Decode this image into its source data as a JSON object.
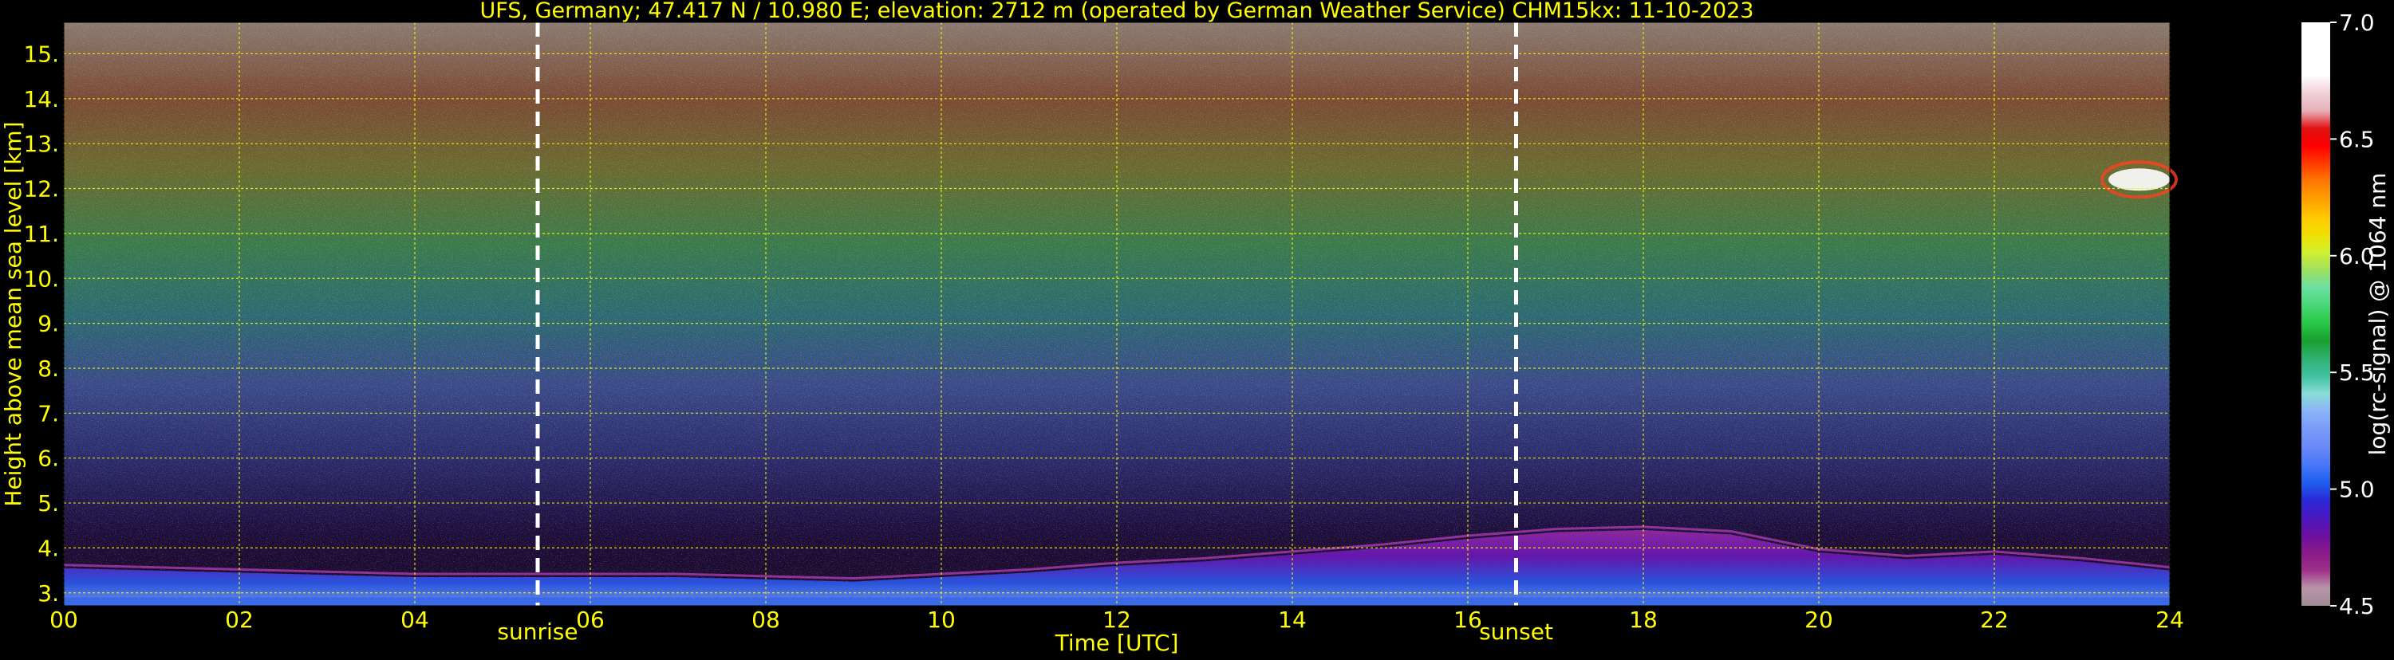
{
  "chart_data": {
    "type": "heatmap",
    "title": "UFS, Germany; 47.417 N / 10.980 E; elevation: 2712 m  (operated by German Weather Service)     CHM15kx: 11-10-2023",
    "xlabel": "Time [UTC]",
    "ylabel": "Height above mean sea level [km]",
    "xlim": [
      0,
      24
    ],
    "ylim": [
      2.712,
      15.7
    ],
    "x_ticks": [
      "00",
      "02",
      "04",
      "06",
      "08",
      "10",
      "12",
      "14",
      "16",
      "18",
      "20",
      "22",
      "24"
    ],
    "y_ticks": [
      "3.",
      "4.",
      "5.",
      "6.",
      "7.",
      "8.",
      "9.",
      "10.",
      "11.",
      "12.",
      "13.",
      "14.",
      "15."
    ],
    "grid": true,
    "grid_color": "#ffff00",
    "label_color": "#ffff00",
    "events": [
      {
        "label": "sunrise",
        "time": 5.4
      },
      {
        "label": "sunset",
        "time": 16.55
      }
    ],
    "colorbar": {
      "label": "log(rc-signal) @ 1064 nm",
      "range": [
        4.5,
        7.0
      ],
      "ticks": [
        "7.0",
        "6.5",
        "6.0",
        "5.5",
        "5.0",
        "4.5"
      ],
      "colors": [
        "#a08a95",
        "#b896aa",
        "#a0308a",
        "#8a1a8a",
        "#6a10a0",
        "#4a18c0",
        "#2a2ad8",
        "#2060f0",
        "#4a78f8",
        "#6a8af8",
        "#7a9af8",
        "#8ab4f8",
        "#8adcd8",
        "#40c0a0",
        "#30b070",
        "#18a030",
        "#28c848",
        "#48d878",
        "#6ae0a0",
        "#a0e060",
        "#d0f030",
        "#f0e000",
        "#ffc800",
        "#ffa000",
        "#ff7800",
        "#ff3c00",
        "#ff0000",
        "#e01010",
        "#e8b0b8",
        "#f0d0d8",
        "#ffffff",
        "#ffffff",
        "#ffffff",
        "#ffffff"
      ]
    },
    "boundary_layer_top_km": {
      "x": [
        0,
        1,
        2,
        3,
        4,
        5,
        6,
        7,
        8,
        9,
        10,
        11,
        12,
        13,
        14,
        15,
        16,
        17,
        18,
        19,
        20,
        21,
        22,
        23,
        24
      ],
      "y": [
        3.55,
        3.5,
        3.45,
        3.4,
        3.35,
        3.35,
        3.35,
        3.35,
        3.3,
        3.25,
        3.35,
        3.45,
        3.6,
        3.7,
        3.85,
        4.0,
        4.2,
        4.35,
        4.4,
        4.3,
        3.9,
        3.75,
        3.85,
        3.7,
        3.5
      ]
    },
    "cirrus_cloud": {
      "time_range": [
        23.3,
        24
      ],
      "height_km": 12.2,
      "value": 7.0
    }
  }
}
